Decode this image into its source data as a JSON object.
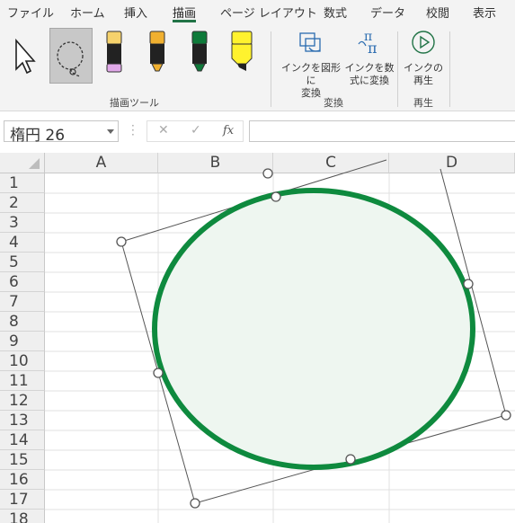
{
  "tabs": [
    {
      "label": "ファイル",
      "active": false
    },
    {
      "label": "ホーム",
      "active": false
    },
    {
      "label": "挿入",
      "active": false
    },
    {
      "label": "描画",
      "active": true
    },
    {
      "label": "ページ レイアウト",
      "active": false
    },
    {
      "label": "数式",
      "active": false
    },
    {
      "label": "データ",
      "active": false
    },
    {
      "label": "校閲",
      "active": false
    },
    {
      "label": "表示",
      "active": false
    }
  ],
  "ribbon": {
    "groups": {
      "drawing_tools": "描画ツール",
      "convert": "変換",
      "replay": "再生"
    },
    "convert_to_shape": [
      "インクを図形に",
      "変換"
    ],
    "convert_to_math": [
      "インクを数",
      "式に変換"
    ],
    "ink_replay": [
      "インクの",
      "再生"
    ],
    "pens": [
      {
        "name": "pencil",
        "color": "#e0a8e8"
      },
      {
        "name": "pen-orange",
        "color": "#f0b030"
      },
      {
        "name": "pen-green",
        "color": "#0e7a3a"
      },
      {
        "name": "highlighter-yellow",
        "color": "#fff22e"
      }
    ]
  },
  "formula_bar": {
    "name_box": "楕円 26",
    "fx": "fx",
    "value": ""
  },
  "sheet": {
    "columns": [
      "A",
      "B",
      "C",
      "D"
    ],
    "rows": [
      "1",
      "2",
      "3",
      "4",
      "5",
      "6",
      "7",
      "8",
      "9",
      "10",
      "11",
      "12",
      "13",
      "14",
      "15",
      "16",
      "17",
      "18"
    ]
  },
  "shape": {
    "type": "ellipse",
    "stroke": "#0e8a3e",
    "fill": "#eef6f0"
  }
}
